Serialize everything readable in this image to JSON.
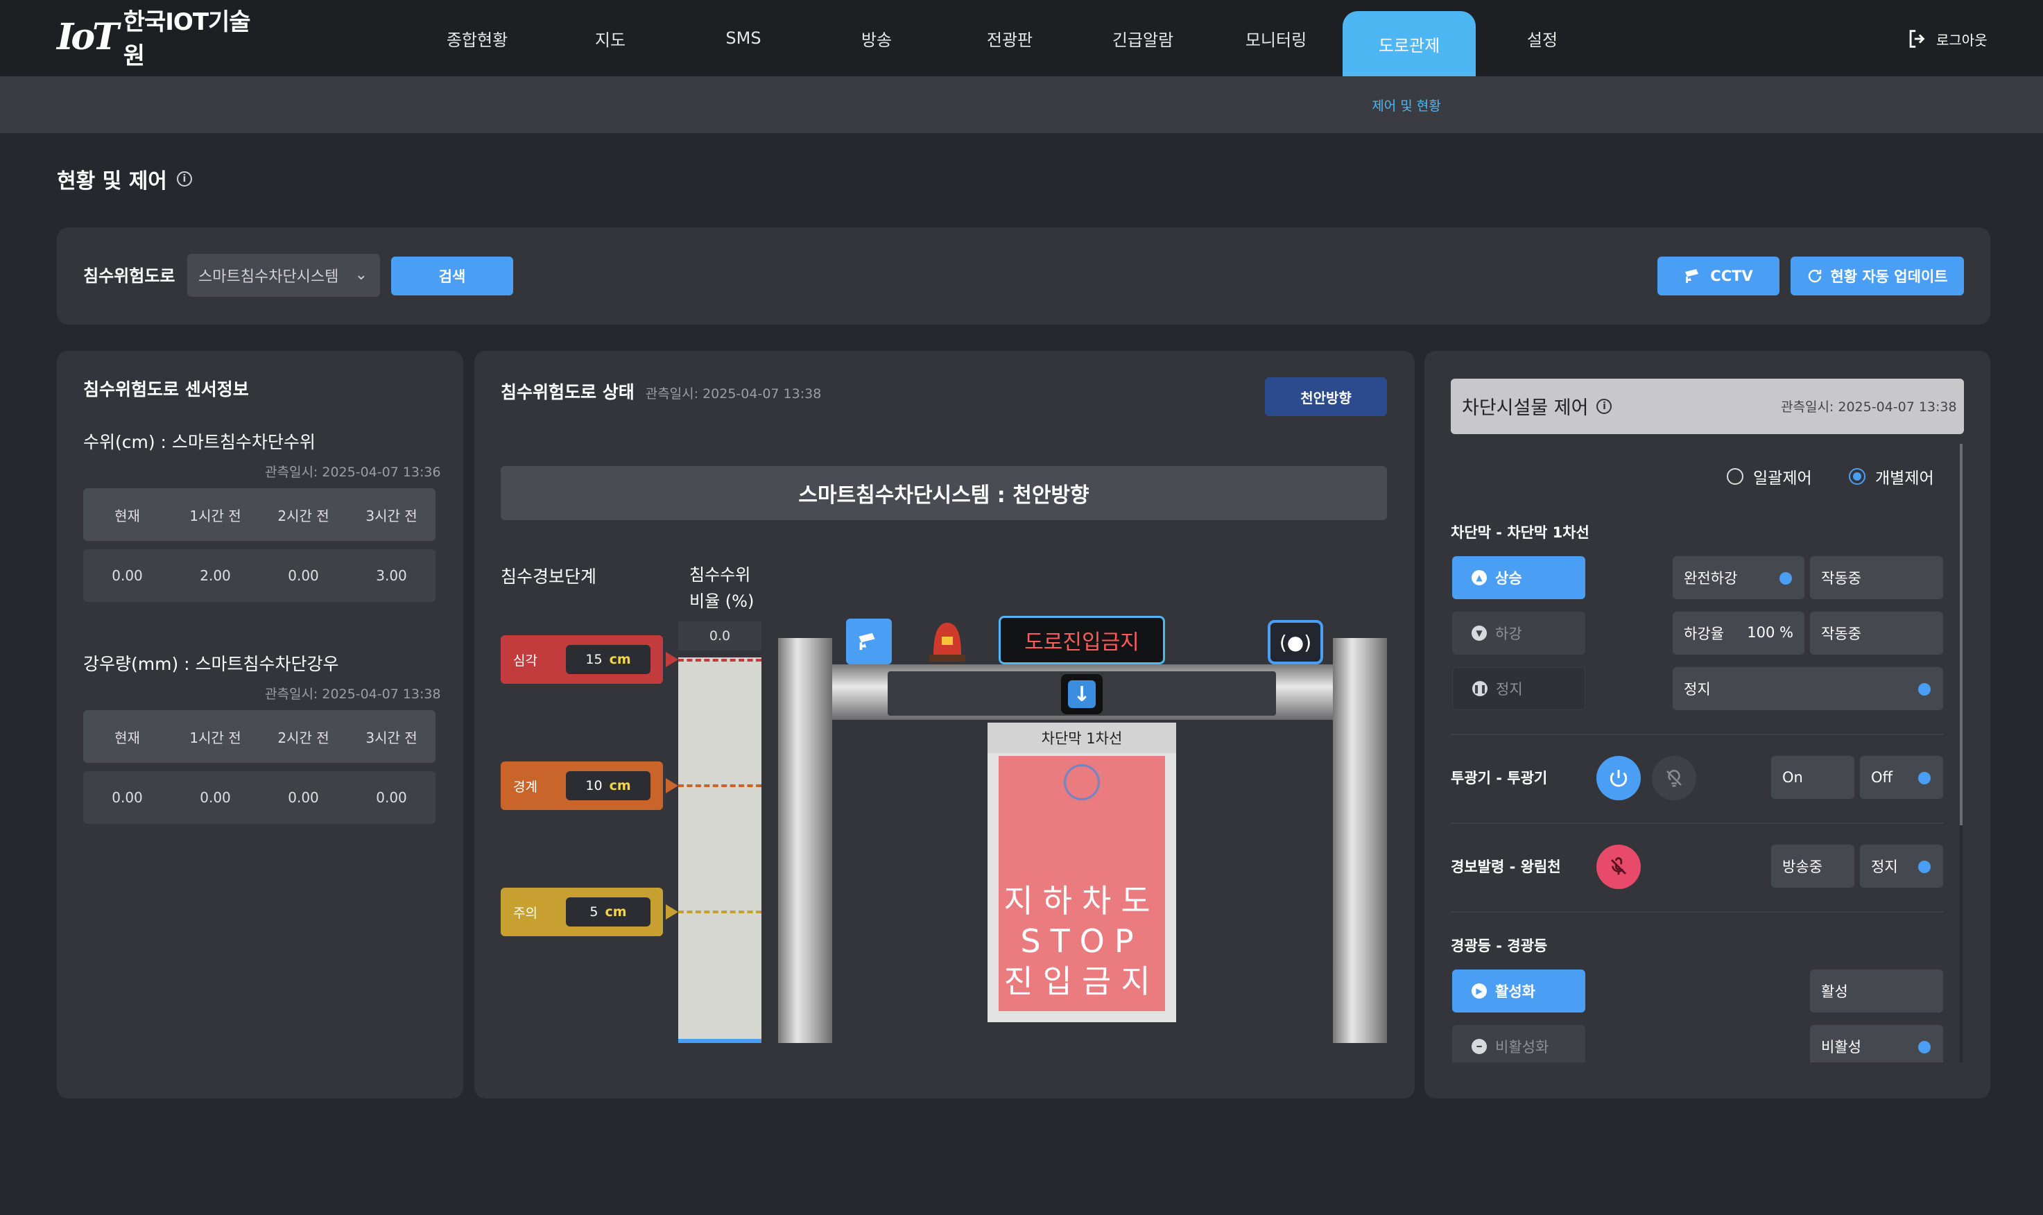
{
  "brand": {
    "mark": "IoT",
    "name": "한국IOT기술원"
  },
  "nav": {
    "items": [
      "종합현황",
      "지도",
      "SMS",
      "방송",
      "전광판",
      "긴급알람",
      "모니터링",
      "도로관제",
      "설정"
    ],
    "active": "도로관제",
    "logout": "로그아웃",
    "sub": "제어 및 현황"
  },
  "page": {
    "title": "현황 및 제어"
  },
  "filter": {
    "label": "침수위험도로",
    "selected": "스마트침수차단시스템",
    "search": "검색",
    "cctv": "CCTV",
    "auto_update": "현황 자동 업데이트"
  },
  "sensor": {
    "title": "침수위험도로 센서정보",
    "water": {
      "title": "수위(cm) : 스마트침수차단수위",
      "ts": "관측일시: 2025-04-07 13:36",
      "headers": [
        "현재",
        "1시간 전",
        "2시간 전",
        "3시간 전"
      ],
      "values": [
        "0.00",
        "2.00",
        "0.00",
        "3.00"
      ]
    },
    "rain": {
      "title": "강우량(mm) : 스마트침수차단강우",
      "ts": "관측일시: 2025-04-07 13:38",
      "headers": [
        "현재",
        "1시간 전",
        "2시간 전",
        "3시간 전"
      ],
      "values": [
        "0.00",
        "0.00",
        "0.00",
        "0.00"
      ]
    }
  },
  "status": {
    "title": "침수위험도로 상태",
    "ts": "관측일시: 2025-04-07 13:38",
    "direction": "천안방향",
    "banner": "스마트침수차단시스템 : 천안방향",
    "alert_title": "침수경보단계",
    "ratio_title_1": "침수수위",
    "ratio_title_2": "비율 (%)",
    "ratio_value": "0.0",
    "ratio_fraction": 0.0,
    "levels": [
      {
        "name": "심각",
        "value": "15",
        "unit": "cm",
        "color": "#c23b3d"
      },
      {
        "name": "경계",
        "value": "10",
        "unit": "cm",
        "color": "#c9652a"
      },
      {
        "name": "주의",
        "value": "5",
        "unit": "cm",
        "color": "#c8a032"
      }
    ],
    "sign": "도로진입금지",
    "lane_label": "차단막 1차선",
    "curtain_lines": [
      "지하차도",
      "STOP",
      "진입금지"
    ]
  },
  "control": {
    "title": "차단시설물 제어",
    "ts": "관측일시: 2025-04-07 13:38",
    "mode": {
      "all": "일괄제어",
      "individual": "개별제어",
      "selected": "개별제어"
    },
    "barrier": {
      "title": "차단막 - 차단막 1차선",
      "up": "상승",
      "down": "하강",
      "stop": "정지",
      "state1": "완전하강",
      "state1b": "작동중",
      "rate_label": "하강율",
      "rate_value": "100 %",
      "state2b": "작동중",
      "stop_state": "정지"
    },
    "floodlight": {
      "title": "투광기 - 투광기",
      "on": "On",
      "off": "Off"
    },
    "alarm": {
      "title": "경보발령 - 왕림천",
      "broadcasting": "방송중",
      "stop": "정지"
    },
    "warning_light": {
      "title": "경광등 - 경광등",
      "activate": "활성화",
      "deactivate": "비활성화",
      "active": "활성",
      "inactive": "비활성"
    }
  },
  "colors": {
    "accent": "#4a9ff5",
    "nav_active": "#4fb6f4",
    "danger": "#e84a6a"
  }
}
